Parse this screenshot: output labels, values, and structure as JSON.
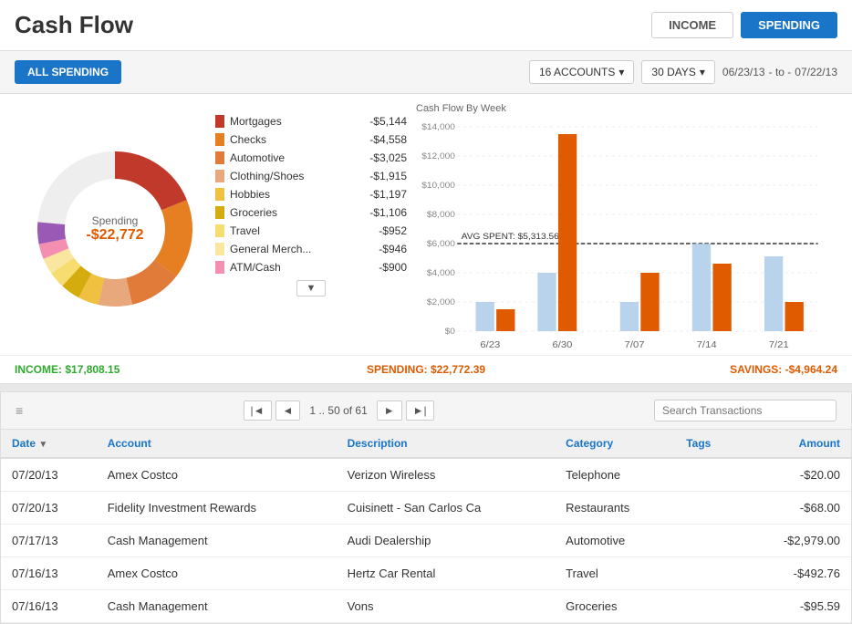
{
  "header": {
    "title": "Cash Flow",
    "income_label": "INCOME",
    "spending_label": "SPENDING"
  },
  "toolbar": {
    "all_spending_label": "ALL SPENDING",
    "accounts_label": "16 ACCOUNTS",
    "days_label": "30 DAYS",
    "date_from": "06/23/13",
    "date_to": "07/22/13",
    "date_separator": "- to -"
  },
  "donut": {
    "label": "Spending",
    "amount": "-$22,772"
  },
  "legend": {
    "items": [
      {
        "name": "Mortgages",
        "amount": "-$5,144",
        "color": "#c0392b"
      },
      {
        "name": "Checks",
        "amount": "-$4,558",
        "color": "#e67e22"
      },
      {
        "name": "Automotive",
        "amount": "-$3,025",
        "color": "#e07b39"
      },
      {
        "name": "Clothing/Shoes",
        "amount": "-$1,915",
        "color": "#e8a87c"
      },
      {
        "name": "Hobbies",
        "amount": "-$1,197",
        "color": "#f0c040"
      },
      {
        "name": "Groceries",
        "amount": "-$1,106",
        "color": "#d4ac0d"
      },
      {
        "name": "Travel",
        "amount": "-$952",
        "color": "#f7dc6f"
      },
      {
        "name": "General Merch...",
        "amount": "-$946",
        "color": "#f9e79f"
      },
      {
        "name": "ATM/Cash",
        "amount": "-$900",
        "color": "#f48fb1"
      }
    ],
    "more_button": "▼"
  },
  "bar_chart": {
    "title": "Cash Flow By Week",
    "avg_label": "AVG SPENT: $5,313.56",
    "x_labels": [
      "6/23",
      "6/30",
      "7/07",
      "7/14",
      "7/21"
    ],
    "y_labels": [
      "$14,000",
      "$12,000",
      "$10,000",
      "$8,000",
      "$6,000",
      "$4,000",
      "$2,000",
      "$0"
    ]
  },
  "summary": {
    "income_label": "INCOME:",
    "income_value": "$17,808.15",
    "spending_label": "SPENDING: $22,772.39",
    "savings_label": "SAVINGS:",
    "savings_value": "-$4,964.24"
  },
  "transactions": {
    "page_info": "1 .. 50 of 61",
    "search_placeholder": "Search Transactions",
    "columns": {
      "date": "Date",
      "account": "Account",
      "description": "Description",
      "category": "Category",
      "tags": "Tags",
      "amount": "Amount"
    },
    "rows": [
      {
        "date": "07/20/13",
        "account": "Amex Costco",
        "description": "Verizon Wireless",
        "category": "Telephone",
        "tags": "",
        "amount": "-$20.00"
      },
      {
        "date": "07/20/13",
        "account": "Fidelity Investment Rewards",
        "description": "Cuisinett - San Carlos Ca",
        "category": "Restaurants",
        "tags": "",
        "amount": "-$68.00"
      },
      {
        "date": "07/17/13",
        "account": "Cash Management",
        "description": "Audi Dealership",
        "category": "Automotive",
        "tags": "",
        "amount": "-$2,979.00"
      },
      {
        "date": "07/16/13",
        "account": "Amex Costco",
        "description": "Hertz Car Rental",
        "category": "Travel",
        "tags": "",
        "amount": "-$492.76"
      },
      {
        "date": "07/16/13",
        "account": "Cash Management",
        "description": "Vons",
        "category": "Groceries",
        "tags": "",
        "amount": "-$95.59"
      }
    ]
  }
}
